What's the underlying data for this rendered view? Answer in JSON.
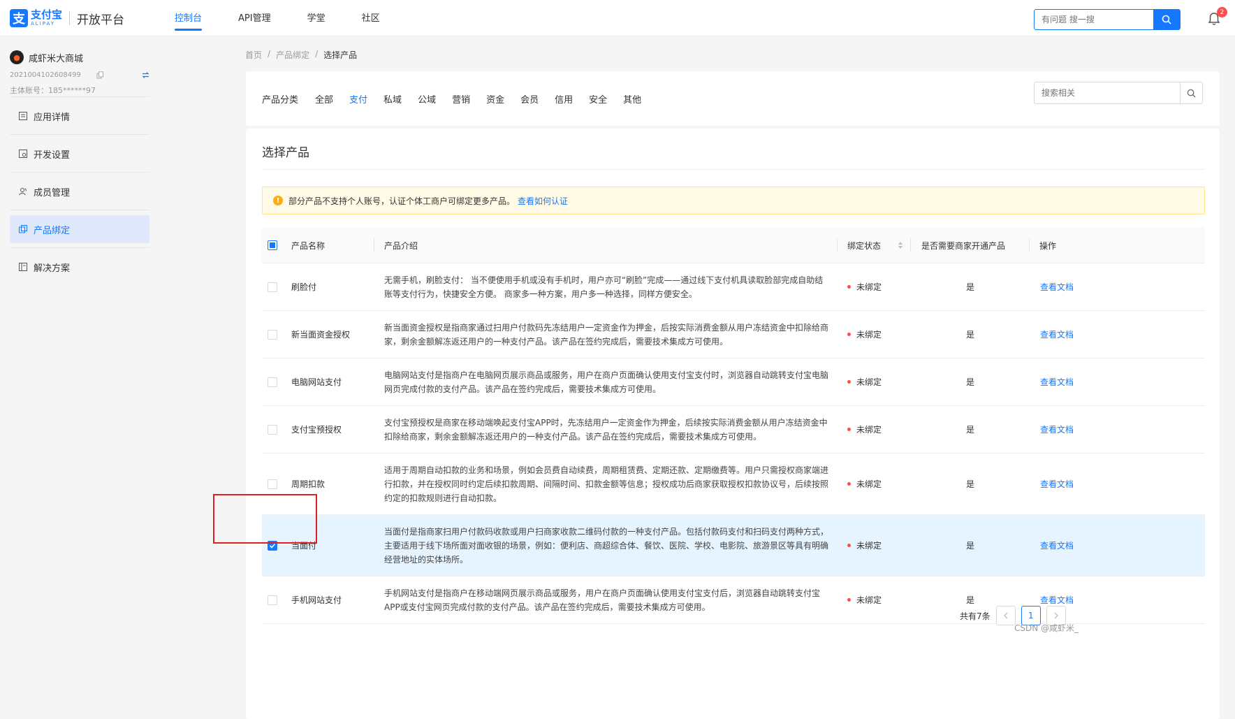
{
  "brand": {
    "logo_cn": "支付宝",
    "logo_en": "ALIPAY",
    "platform": "开放平台"
  },
  "nav": [
    {
      "label": "控制台",
      "active": true
    },
    {
      "label": "API管理",
      "active": false
    },
    {
      "label": "学堂",
      "active": false
    },
    {
      "label": "社区",
      "active": false
    }
  ],
  "top_search": {
    "placeholder": "有问题 搜一搜"
  },
  "notifications": {
    "count": "2"
  },
  "account": {
    "name": "咸虾米大商城",
    "app_id": "2021004102608499",
    "main_account": "主体账号：185******97"
  },
  "sidebar": {
    "items": [
      {
        "label": "应用详情",
        "icon": "app-detail-icon",
        "active": false
      },
      {
        "label": "开发设置",
        "icon": "dev-settings-icon",
        "active": false
      },
      {
        "label": "成员管理",
        "icon": "members-icon",
        "active": false
      },
      {
        "label": "产品绑定",
        "icon": "product-bind-icon",
        "active": true
      },
      {
        "label": "解决方案",
        "icon": "solution-icon",
        "active": false
      }
    ]
  },
  "breadcrumb": [
    "首页",
    "产品绑定",
    "选择产品"
  ],
  "filter": {
    "label": "产品分类",
    "categories": [
      {
        "label": "全部",
        "active": false
      },
      {
        "label": "支付",
        "active": true
      },
      {
        "label": "私域",
        "active": false
      },
      {
        "label": "公域",
        "active": false
      },
      {
        "label": "营销",
        "active": false
      },
      {
        "label": "资金",
        "active": false
      },
      {
        "label": "会员",
        "active": false
      },
      {
        "label": "信用",
        "active": false
      },
      {
        "label": "安全",
        "active": false
      },
      {
        "label": "其他",
        "active": false
      }
    ],
    "search_placeholder": "搜索相关"
  },
  "card": {
    "title": "选择产品",
    "alert_text": "部分产品不支持个人账号，认证个体工商户可绑定更多产品。",
    "alert_link": "查看如何认证"
  },
  "table": {
    "headers": {
      "name": "产品名称",
      "intro": "产品介绍",
      "status": "绑定状态",
      "need_merchant": "是否需要商家开通产品",
      "action": "操作"
    },
    "rows": [
      {
        "name": "刷脸付",
        "intro": "无需手机，刷脸支付： 当不便使用手机或没有手机时，用户亦可“刷脸”完成——通过线下支付机具读取脸部完成自助结账等支付行为，快捷安全方便。 商家多一种方案，用户多一种选择，同样方便安全。",
        "status": "未绑定",
        "need": "是",
        "action": "查看文档",
        "checked": false
      },
      {
        "name": "新当面资金授权",
        "intro": "新当面资金授权是指商家通过扫用户付款码先冻结用户一定资金作为押金，后按实际消费金额从用户冻结资金中扣除给商家，剩余金额解冻返还用户的一种支付产品。该产品在签约完成后，需要技术集成方可使用。",
        "status": "未绑定",
        "need": "是",
        "action": "查看文档",
        "checked": false
      },
      {
        "name": "电脑网站支付",
        "intro": "电脑网站支付是指商户在电脑网页展示商品或服务，用户在商户页面确认使用支付宝支付时，浏览器自动跳转支付宝电脑网页完成付款的支付产品。该产品在签约完成后，需要技术集成方可使用。",
        "status": "未绑定",
        "need": "是",
        "action": "查看文档",
        "checked": false
      },
      {
        "name": "支付宝预授权",
        "intro": "支付宝预授权是商家在移动端唤起支付宝APP时，先冻结用户一定资金作为押金，后续按实际消费金额从用户冻结资金中扣除给商家，剩余金额解冻返还用户的一种支付产品。该产品在签约完成后，需要技术集成方可使用。",
        "status": "未绑定",
        "need": "是",
        "action": "查看文档",
        "checked": false
      },
      {
        "name": "周期扣款",
        "intro": "适用于周期自动扣款的业务和场景，例如会员费自动续费，周期租赁费、定期还款、定期缴费等。用户只需授权商家端进行扣款，并在授权同时约定后续扣款周期、间隔时间、扣款金额等信息；授权成功后商家获取授权扣款协议号，后续按照约定的扣款规则进行自动扣款。",
        "status": "未绑定",
        "need": "是",
        "action": "查看文档",
        "checked": false
      },
      {
        "name": "当面付",
        "intro": "当面付是指商家扫用户付款码收款或用户扫商家收款二维码付款的一种支付产品。包括付款码支付和扫码支付两种方式，主要适用于线下场所面对面收银的场景，例如：便利店、商超综合体、餐饮、医院、学校、电影院、旅游景区等具有明确经营地址的实体场所。",
        "status": "未绑定",
        "need": "是",
        "action": "查看文档",
        "checked": true
      },
      {
        "name": "手机网站支付",
        "intro": "手机网站支付是指商户在移动端网页展示商品或服务，用户在商户页面确认使用支付宝支付后，浏览器自动跳转支付宝APP或支付宝网页完成付款的支付产品。该产品在签约完成后，需要技术集成方可使用。",
        "status": "未绑定",
        "need": "是",
        "action": "查看文档",
        "checked": false
      }
    ]
  },
  "pagination": {
    "total": "共有7条",
    "current": "1"
  },
  "watermark": "CSDN @咸虾米_",
  "colors": {
    "accent": "#1677ff",
    "unbound_dot": "#ff4d4f",
    "selected_row": "#e6f4ff",
    "alert_bg": "#fffbe6",
    "annotation": "#e02020"
  }
}
